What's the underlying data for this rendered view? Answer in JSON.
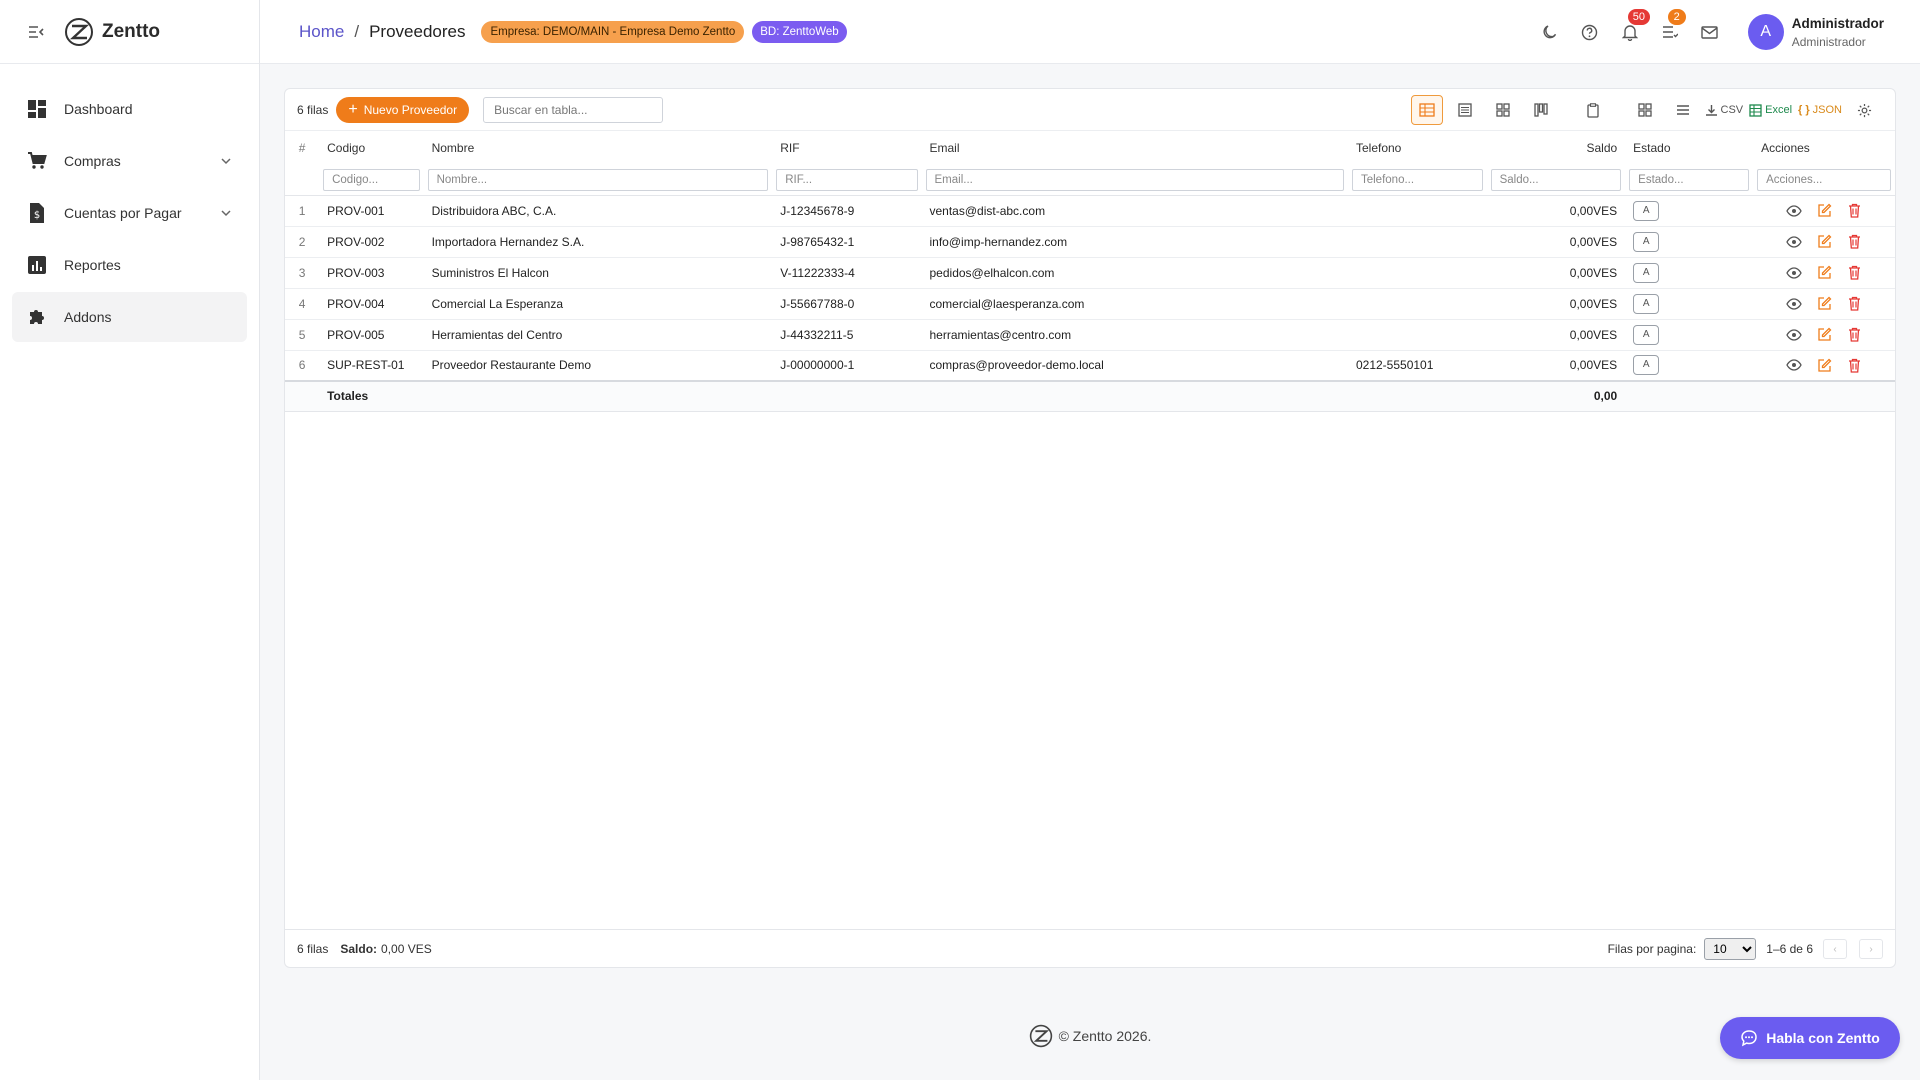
{
  "brand": {
    "name": "Zentto"
  },
  "sidebar": {
    "items": [
      {
        "label": "Dashboard",
        "icon": "dashboard-icon",
        "has_children": false
      },
      {
        "label": "Compras",
        "icon": "cart-icon",
        "has_children": true
      },
      {
        "label": "Cuentas por Pagar",
        "icon": "invoice-icon",
        "has_children": true
      },
      {
        "label": "Reportes",
        "icon": "report-icon",
        "has_children": false
      },
      {
        "label": "Addons",
        "icon": "puzzle-icon",
        "has_children": false,
        "active": true
      }
    ]
  },
  "header": {
    "breadcrumb": {
      "home": "Home",
      "separator": "/",
      "current": "Proveedores"
    },
    "empresa_badge": "Empresa: DEMO/MAIN - Empresa Demo Zentto",
    "bd_badge": "BD: ZenttoWeb",
    "notifications_count": "50",
    "tasks_count": "2",
    "user": {
      "initial": "A",
      "name": "Administrador",
      "role": "Administrador"
    }
  },
  "toolbar": {
    "row_count": "6 filas",
    "new_button": "Nuevo Proveedor",
    "search_placeholder": "Buscar en tabla...",
    "csv": "CSV",
    "excel": "Excel",
    "json": "JSON"
  },
  "table": {
    "headers": [
      "#",
      "Codigo",
      "Nombre",
      "RIF",
      "Email",
      "Telefono",
      "Saldo",
      "Estado",
      "Acciones"
    ],
    "filters": [
      "Codigo...",
      "Nombre...",
      "RIF...",
      "Email...",
      "Telefono...",
      "Saldo...",
      "Estado...",
      "Acciones..."
    ],
    "rows": [
      {
        "n": "1",
        "codigo": "PROV-001",
        "nombre": "Distribuidora ABC, C.A.",
        "rif": "J-12345678-9",
        "email": "ventas@dist-abc.com",
        "telefono": "",
        "saldo": "0,00VES",
        "estado": "A"
      },
      {
        "n": "2",
        "codigo": "PROV-002",
        "nombre": "Importadora Hernandez S.A.",
        "rif": "J-98765432-1",
        "email": "info@imp-hernandez.com",
        "telefono": "",
        "saldo": "0,00VES",
        "estado": "A"
      },
      {
        "n": "3",
        "codigo": "PROV-003",
        "nombre": "Suministros El Halcon",
        "rif": "V-11222333-4",
        "email": "pedidos@elhalcon.com",
        "telefono": "",
        "saldo": "0,00VES",
        "estado": "A"
      },
      {
        "n": "4",
        "codigo": "PROV-004",
        "nombre": "Comercial La Esperanza",
        "rif": "J-55667788-0",
        "email": "comercial@laesperanza.com",
        "telefono": "",
        "saldo": "0,00VES",
        "estado": "A"
      },
      {
        "n": "5",
        "codigo": "PROV-005",
        "nombre": "Herramientas del Centro",
        "rif": "J-44332211-5",
        "email": "herramientas@centro.com",
        "telefono": "",
        "saldo": "0,00VES",
        "estado": "A"
      },
      {
        "n": "6",
        "codigo": "SUP-REST-01",
        "nombre": "Proveedor Restaurante Demo",
        "rif": "J-00000000-1",
        "email": "compras@proveedor-demo.local",
        "telefono": "0212-5550101",
        "saldo": "0,00VES",
        "estado": "A"
      }
    ],
    "totals": {
      "label": "Totales",
      "saldo": "0,00"
    }
  },
  "footer_bar": {
    "row_count": "6 filas",
    "saldo_label": "Saldo:",
    "saldo_value": "0,00 VES",
    "per_page_label": "Filas por pagina:",
    "per_page_value": "10",
    "range": "1–6 de 6"
  },
  "page_footer": {
    "copyright": "© Zentto 2026."
  },
  "chat": {
    "label": "Habla con Zentto"
  },
  "colors": {
    "accent": "#ef7c1a",
    "brand": "#6b5cf0",
    "danger": "#e53935"
  }
}
